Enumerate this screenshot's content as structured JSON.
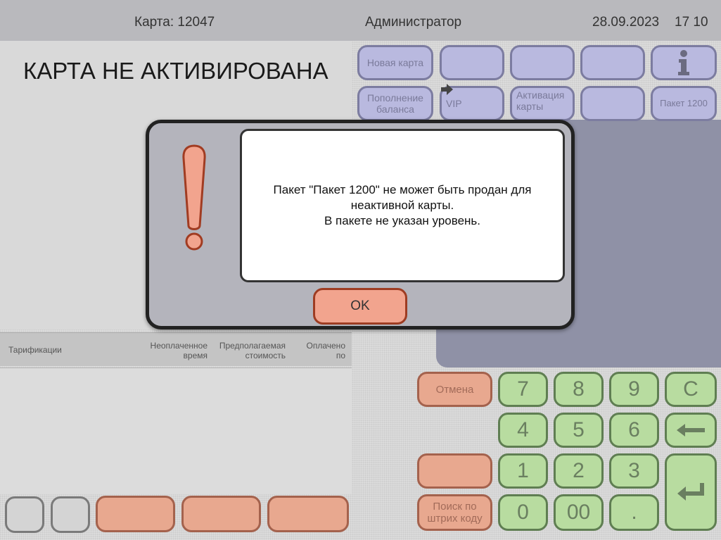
{
  "header": {
    "card": "Карта: 12047",
    "user": "Администратор",
    "date": "28.09.2023",
    "time": "17 10"
  },
  "card_status": "КАРТА НЕ АКТИВИРОВАНА",
  "panel_buttons": {
    "new_card": "Новая карта",
    "top_up_1": "Пополнение",
    "top_up_2": "баланса",
    "vip": "VIP",
    "activate_1": "Активация",
    "activate_2": "карты",
    "package": "Пакет 1200",
    "info_glyph": "i"
  },
  "tariff_header": {
    "tariffs": "Тарификации",
    "unpaid_1": "Неоплаченное",
    "unpaid_2": "время",
    "estimated_1": "Предполагаемая",
    "estimated_2": "стоимость",
    "paid_1": "Оплачено",
    "paid_2": "по"
  },
  "keypad": {
    "cancel": "Отмена",
    "search_1": "Поиск по",
    "search_2": "штрих коду",
    "k7": "7",
    "k8": "8",
    "k9": "9",
    "kC": "C",
    "k4": "4",
    "k5": "5",
    "k6": "6",
    "k1": "1",
    "k2": "2",
    "k3": "3",
    "k0": "0",
    "k00": "00",
    "kdot": "."
  },
  "dialog": {
    "line1": "Пакет \"Пакет 1200\" не может быть продан для",
    "line2": "неактивной карты.",
    "line3": "В пакете не указан уровень.",
    "ok": "OK"
  }
}
